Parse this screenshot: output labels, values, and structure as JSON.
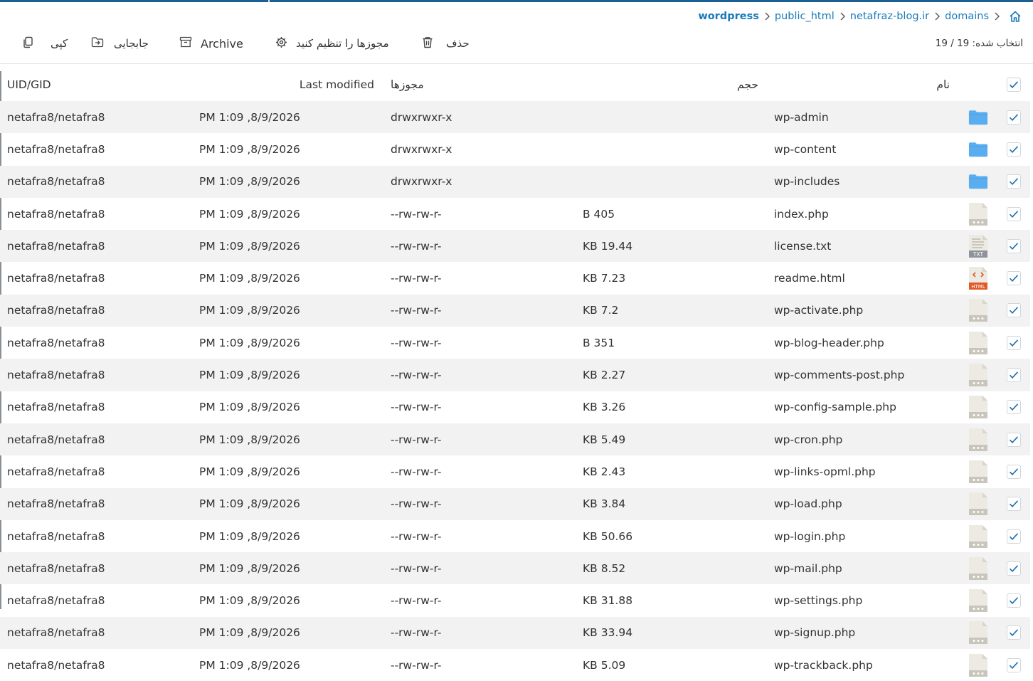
{
  "breadcrumb": [
    "wordpress",
    "public_html",
    "netafraz-blog.ir",
    "domains"
  ],
  "toolbar": {
    "copy_label": "کپی",
    "move_label": "جابجایی",
    "archive_label": "Archive",
    "permissions_label": "مجوزها را تنظیم کنید",
    "delete_label": "حذف",
    "selected_text": "انتخاب شده: 19 / 19"
  },
  "columns": {
    "uid": "UID/GID",
    "modified": "Last modified",
    "permissions": "مجوزها",
    "size": "حجم",
    "name": "نام"
  },
  "colors": {
    "accent": "#1a7bb8",
    "folder": "#5aaef0",
    "row_alt": "#f2f2f2",
    "top_bar": "#1c5f92"
  },
  "files": [
    {
      "name": "wp-admin",
      "type": "folder",
      "size": "",
      "perm": "drwxrwxr-x",
      "modified": "PM 1:09 ,8/9/2026",
      "uid": "netafra8/netafra8",
      "checked": true
    },
    {
      "name": "wp-content",
      "type": "folder",
      "size": "",
      "perm": "drwxrwxr-x",
      "modified": "PM 1:09 ,8/9/2026",
      "uid": "netafra8/netafra8",
      "checked": true
    },
    {
      "name": "wp-includes",
      "type": "folder",
      "size": "",
      "perm": "drwxrwxr-x",
      "modified": "PM 1:09 ,8/9/2026",
      "uid": "netafra8/netafra8",
      "checked": true
    },
    {
      "name": "index.php",
      "type": "file",
      "size": "B 405",
      "perm": "--rw-rw-r-",
      "modified": "PM 1:09 ,8/9/2026",
      "uid": "netafra8/netafra8",
      "checked": true
    },
    {
      "name": "license.txt",
      "type": "txt",
      "size": "KB 19.44",
      "perm": "--rw-rw-r-",
      "modified": "PM 1:09 ,8/9/2026",
      "uid": "netafra8/netafra8",
      "checked": true
    },
    {
      "name": "readme.html",
      "type": "html",
      "size": "KB 7.23",
      "perm": "--rw-rw-r-",
      "modified": "PM 1:09 ,8/9/2026",
      "uid": "netafra8/netafra8",
      "checked": true
    },
    {
      "name": "wp-activate.php",
      "type": "file",
      "size": "KB 7.2",
      "perm": "--rw-rw-r-",
      "modified": "PM 1:09 ,8/9/2026",
      "uid": "netafra8/netafra8",
      "checked": true
    },
    {
      "name": "wp-blog-header.php",
      "type": "file",
      "size": "B 351",
      "perm": "--rw-rw-r-",
      "modified": "PM 1:09 ,8/9/2026",
      "uid": "netafra8/netafra8",
      "checked": true
    },
    {
      "name": "wp-comments-post.php",
      "type": "file",
      "size": "KB 2.27",
      "perm": "--rw-rw-r-",
      "modified": "PM 1:09 ,8/9/2026",
      "uid": "netafra8/netafra8",
      "checked": true
    },
    {
      "name": "wp-config-sample.php",
      "type": "file",
      "size": "KB 3.26",
      "perm": "--rw-rw-r-",
      "modified": "PM 1:09 ,8/9/2026",
      "uid": "netafra8/netafra8",
      "checked": true
    },
    {
      "name": "wp-cron.php",
      "type": "file",
      "size": "KB 5.49",
      "perm": "--rw-rw-r-",
      "modified": "PM 1:09 ,8/9/2026",
      "uid": "netafra8/netafra8",
      "checked": true
    },
    {
      "name": "wp-links-opml.php",
      "type": "file",
      "size": "KB 2.43",
      "perm": "--rw-rw-r-",
      "modified": "PM 1:09 ,8/9/2026",
      "uid": "netafra8/netafra8",
      "checked": true
    },
    {
      "name": "wp-load.php",
      "type": "file",
      "size": "KB 3.84",
      "perm": "--rw-rw-r-",
      "modified": "PM 1:09 ,8/9/2026",
      "uid": "netafra8/netafra8",
      "checked": true
    },
    {
      "name": "wp-login.php",
      "type": "file",
      "size": "KB 50.66",
      "perm": "--rw-rw-r-",
      "modified": "PM 1:09 ,8/9/2026",
      "uid": "netafra8/netafra8",
      "checked": true
    },
    {
      "name": "wp-mail.php",
      "type": "file",
      "size": "KB 8.52",
      "perm": "--rw-rw-r-",
      "modified": "PM 1:09 ,8/9/2026",
      "uid": "netafra8/netafra8",
      "checked": true
    },
    {
      "name": "wp-settings.php",
      "type": "file",
      "size": "KB 31.88",
      "perm": "--rw-rw-r-",
      "modified": "PM 1:09 ,8/9/2026",
      "uid": "netafra8/netafra8",
      "checked": true
    },
    {
      "name": "wp-signup.php",
      "type": "file",
      "size": "KB 33.94",
      "perm": "--rw-rw-r-",
      "modified": "PM 1:09 ,8/9/2026",
      "uid": "netafra8/netafra8",
      "checked": true
    },
    {
      "name": "wp-trackback.php",
      "type": "file",
      "size": "KB 5.09",
      "perm": "--rw-rw-r-",
      "modified": "PM 1:09 ,8/9/2026",
      "uid": "netafra8/netafra8",
      "checked": true
    }
  ]
}
